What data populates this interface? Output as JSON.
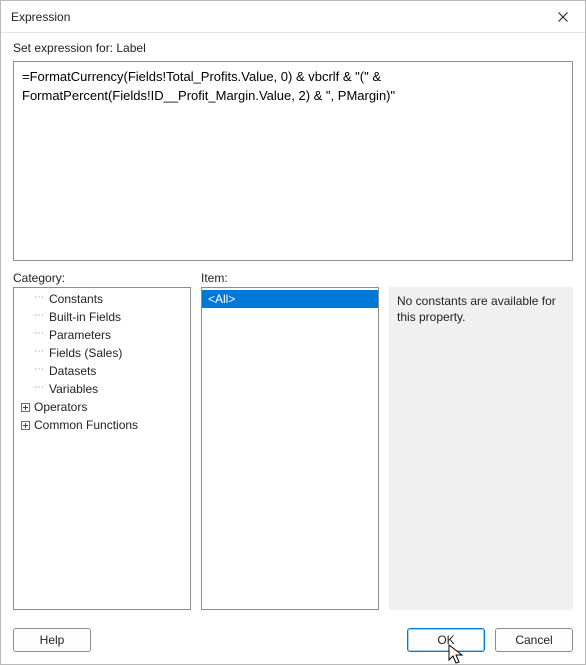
{
  "window": {
    "title": "Expression"
  },
  "header": {
    "set_expression_for": "Set expression for: Label"
  },
  "expression": {
    "text": "=FormatCurrency(Fields!Total_Profits.Value, 0) & vbcrlf & \"(\" & FormatPercent(Fields!ID__Profit_Margin.Value, 2) & \", PMargin)\""
  },
  "labels": {
    "category": "Category:",
    "item": "Item:"
  },
  "category": {
    "items": [
      {
        "label": "Constants",
        "expandable": false,
        "expanded": false,
        "dotted": true
      },
      {
        "label": "Built-in Fields",
        "expandable": false,
        "expanded": false,
        "dotted": true
      },
      {
        "label": "Parameters",
        "expandable": false,
        "expanded": false,
        "dotted": true
      },
      {
        "label": "Fields (Sales)",
        "expandable": false,
        "expanded": false,
        "dotted": true
      },
      {
        "label": "Datasets",
        "expandable": false,
        "expanded": false,
        "dotted": true
      },
      {
        "label": "Variables",
        "expandable": false,
        "expanded": false,
        "dotted": true
      },
      {
        "label": "Operators",
        "expandable": true,
        "expanded": false,
        "dotted": false
      },
      {
        "label": "Common Functions",
        "expandable": true,
        "expanded": false,
        "dotted": false
      }
    ],
    "selected_index": 0
  },
  "item_list": {
    "items": [
      {
        "label": "<All>"
      }
    ],
    "selected_index": 0
  },
  "description": {
    "text": "No constants are available for this property."
  },
  "footer": {
    "help": "Help",
    "ok": "OK",
    "cancel": "Cancel"
  }
}
